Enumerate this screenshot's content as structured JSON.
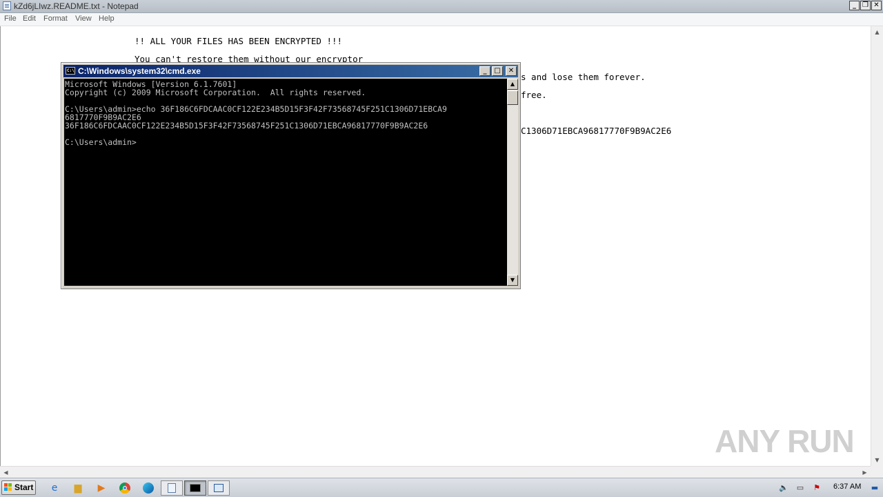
{
  "notepad": {
    "title": "kZd6jLIwz.README.txt - Notepad",
    "menu": [
      "File",
      "Edit",
      "Format",
      "View",
      "Help"
    ],
    "lines": [
      "!! ALL YOUR FILES HAS BEEN ENCRYPTED !!!",
      "You can't restore them without our encryptor",
      "s and lose them forever.",
      "free.",
      "C1306D71EBCA96817770F9B9AC2E6"
    ]
  },
  "cmd": {
    "title": "C:\\Windows\\system32\\cmd.exe",
    "icon_label": "C:\\",
    "lines": [
      "Microsoft Windows [Version 6.1.7601]",
      "Copyright (c) 2009 Microsoft Corporation.  All rights reserved.",
      "",
      "C:\\Users\\admin>echo 36F186C6FDCAAC0CF122E234B5D15F3F42F73568745F251C1306D71EBCA9",
      "6817770F9B9AC2E6",
      "36F186C6FDCAAC0CF122E234B5D15F3F42F73568745F251C1306D71EBCA96817770F9B9AC2E6",
      "",
      "C:\\Users\\admin>"
    ]
  },
  "taskbar": {
    "start_label": "Start",
    "clock": "6:37 AM",
    "pinned_icons": [
      "internet-explorer-icon",
      "file-explorer-icon",
      "media-player-icon",
      "chrome-icon",
      "edge-icon",
      "notepad-icon",
      "cmd-icon",
      "remote-desktop-icon"
    ],
    "tray_icons": [
      "volume-icon",
      "network-icon",
      "action-center-icon",
      "show-desktop-icon"
    ]
  },
  "watermark": "ANY RUN",
  "colors": {
    "cmd_title_gradient_start": "#0a246a",
    "cmd_title_gradient_end": "#3a6ea5",
    "console_bg": "#000000",
    "console_text": "#c0c0c0"
  }
}
